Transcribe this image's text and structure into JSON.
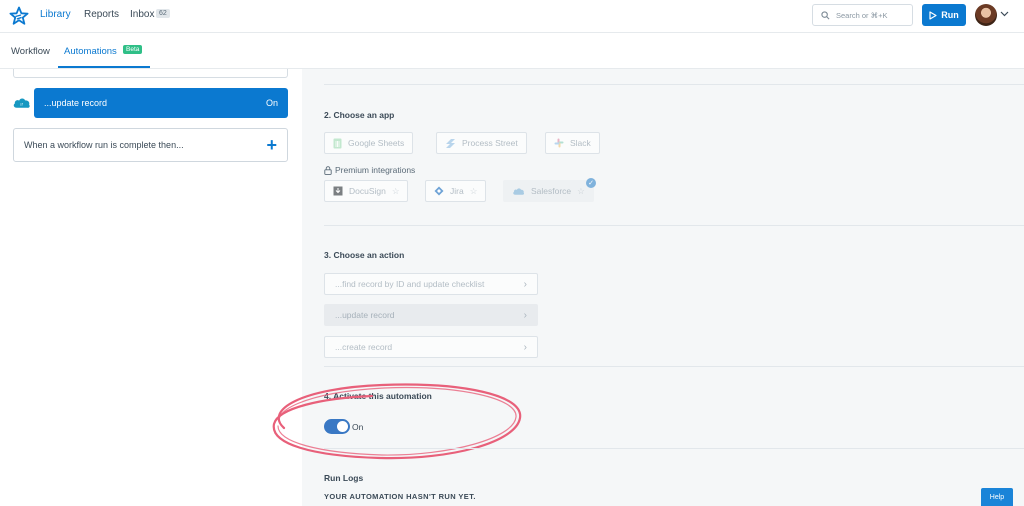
{
  "header": {
    "nav": {
      "library": "Library",
      "reports": "Reports",
      "inbox": "Inbox",
      "inbox_count": "62"
    },
    "search_placeholder": "Search or ⌘+K",
    "run_label": "Run"
  },
  "tabs": {
    "workflow": "Workflow",
    "automations": "Automations",
    "beta": "Beta"
  },
  "left": {
    "active_rule": {
      "label": "...update record",
      "status": "On"
    },
    "add_rule_label": "When a workflow run is complete then..."
  },
  "sections": {
    "choose_app": {
      "title": "2. Choose an app",
      "apps": [
        "Google Sheets",
        "Process Street",
        "Slack"
      ],
      "premium_label": "Premium integrations",
      "premium_apps": [
        "DocuSign",
        "Jira",
        "Salesforce"
      ]
    },
    "choose_action": {
      "title": "3. Choose an action",
      "actions": [
        "...find record by ID and update checklist",
        "...update record",
        "...create record"
      ]
    },
    "activate": {
      "title": "4. Activate this automation",
      "toggle_label": "On"
    },
    "run_logs": {
      "title": "Run Logs",
      "message": "YOUR AUTOMATION HASN'T RUN YET."
    }
  },
  "help_label": "Help",
  "colors": {
    "accent": "#0b79d0",
    "beta": "#2fbf87",
    "annotation": "#e8607a"
  },
  "icons": {
    "logo": "star-logo-icon",
    "search": "search-icon",
    "run": "play-icon",
    "caret": "chevron-down-icon",
    "salesforce": "salesforce-cloud-icon",
    "plus": "plus-icon",
    "lock": "lock-icon",
    "star": "star-icon",
    "check": "check-badge-icon",
    "chevron": "chevron-right-icon"
  }
}
